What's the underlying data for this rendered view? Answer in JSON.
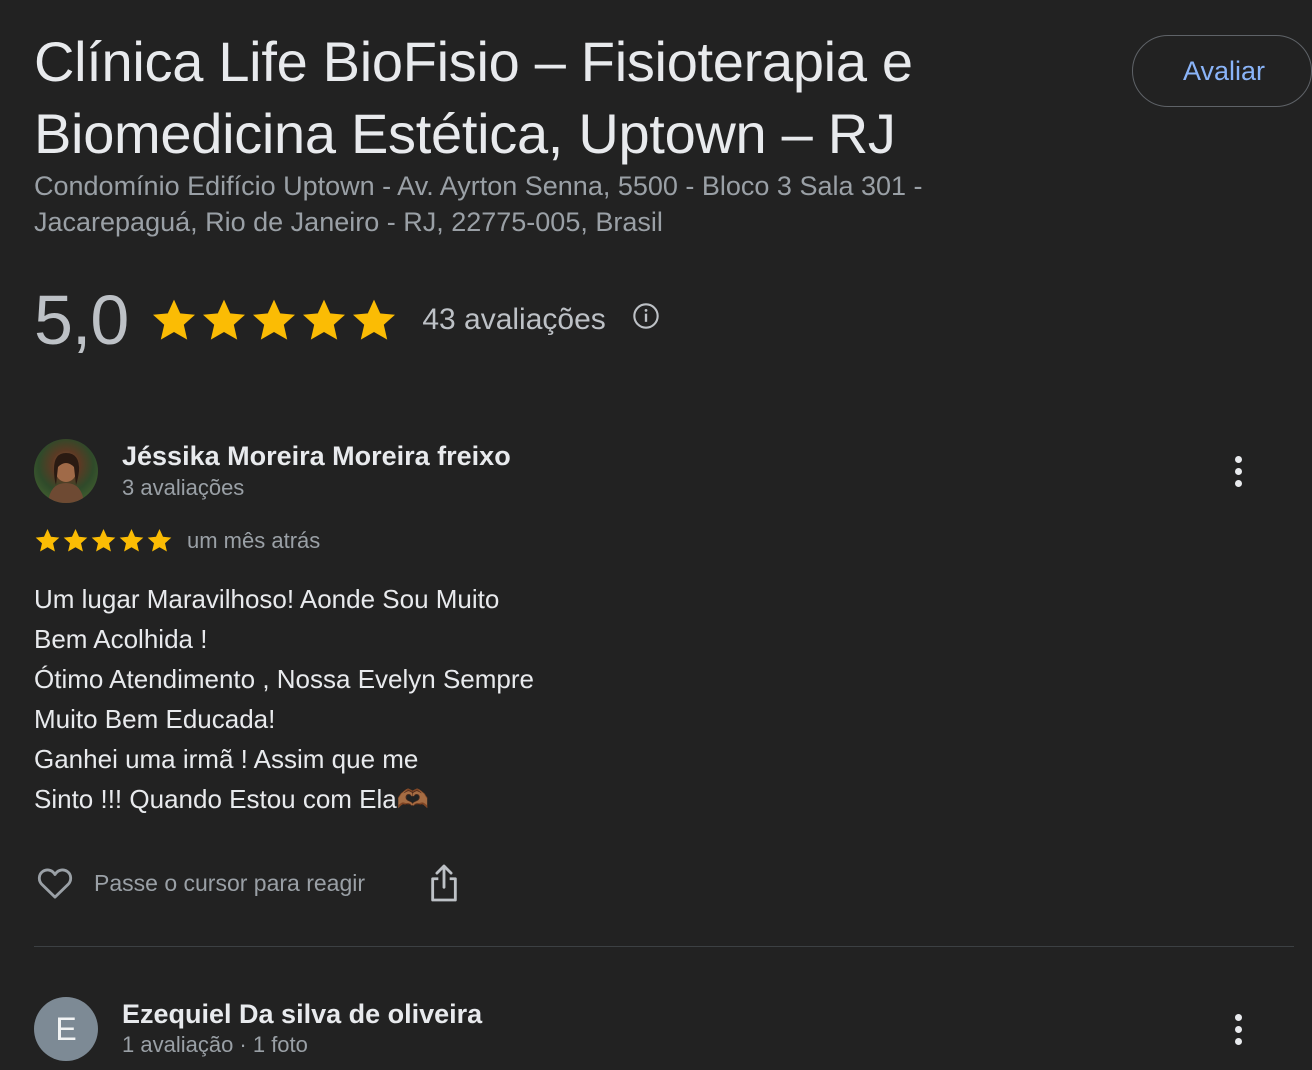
{
  "place": {
    "title_line1": "Clínica Life BioFisio – Fisioterapia e",
    "title_line2": "Biomedicina Estética, Uptown – RJ",
    "address_line1": "Condomínio Edifício Uptown - Av. Ayrton Senna, 5500 - Bloco 3 Sala 301 -",
    "address_line2": "Jacarepaguá, Rio de Janeiro - RJ, 22775-005, Brasil",
    "rate_button_label": "Avaliar"
  },
  "summary": {
    "rating": "5,0",
    "stars": 5,
    "review_count_label": "43 avaliações",
    "info_icon": "info-circle-icon"
  },
  "colors": {
    "background": "#222222",
    "star": "#fbbc04",
    "accent_link": "#8ab4f8"
  },
  "reviews": [
    {
      "name": "Jéssika Moreira Moreira freixo",
      "meta": "3 avaliações",
      "stars": 5,
      "date": "um mês atrás",
      "text_lines": [
        "Um lugar Maravilhoso! Aonde Sou Muito",
        "Bem Acolhida !",
        "Ótimo Atendimento , Nossa Evelyn Sempre",
        "Muito Bem Educada!",
        "Ganhei uma irmã ! Assim que me",
        "Sinto !!! Quando Estou com Ela🫶🏾"
      ],
      "react_label": "Passe o cursor para reagir"
    },
    {
      "name": "Ezequiel Da silva de oliveira",
      "meta": "1 avaliação · 1 foto",
      "avatar_letter": "E"
    }
  ]
}
